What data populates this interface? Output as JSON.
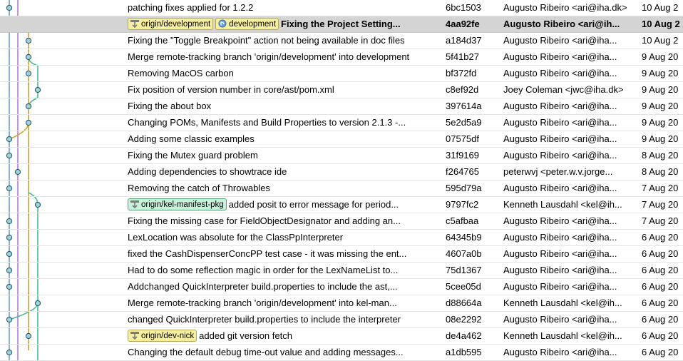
{
  "colors": {
    "lane_blue": "#6b9cc8",
    "lane_purple": "#b57ad0",
    "lane_gold": "#c8a233",
    "lane_teal": "#49b899",
    "selection": "#d4d4d4"
  },
  "commits": [
    {
      "subject": "patching fixes applied for 1.2.2",
      "refs": [],
      "sha": "6bc1503",
      "author": "Augusto Ribeiro <ari@iha.dk>",
      "date": "10 Aug 2",
      "lane": 0
    },
    {
      "subject": "Fixing the Project Setting...",
      "refs": [
        {
          "label": "origin/development",
          "kind": "remote",
          "icon": "remote-branch-icon"
        },
        {
          "label": "development",
          "kind": "local",
          "icon": "local-branch-icon"
        }
      ],
      "sha": "4aa92fe",
      "author": "Augusto Ribeiro <ari@ih...",
      "date": "10 Aug 2",
      "lane": 2,
      "selected": true
    },
    {
      "subject": "Fixing the \"Toggle Breakpoint\" action not being available in doc files",
      "refs": [],
      "sha": "a184d37",
      "author": "Augusto Ribeiro <ari@iha...",
      "date": "10 Aug 2",
      "lane": 2
    },
    {
      "subject": "Merge remote-tracking branch 'origin/development' into development",
      "refs": [],
      "sha": "5f41b27",
      "author": "Augusto Ribeiro <ari@iha...",
      "date": "9 Aug 20",
      "lane": 2
    },
    {
      "subject": "Removing MacOS carbon",
      "refs": [],
      "sha": "bf372fd",
      "author": "Augusto Ribeiro <ari@iha...",
      "date": "9 Aug 20",
      "lane": 2
    },
    {
      "subject": "Fix position of version number in core/ast/pom.xml",
      "refs": [],
      "sha": "c8ef92d",
      "author": "Joey Coleman <jwc@iha.dk>",
      "date": "9 Aug 20",
      "lane": 3
    },
    {
      "subject": "Fixing the about box",
      "refs": [],
      "sha": "397614a",
      "author": "Augusto Ribeiro <ari@iha...",
      "date": "9 Aug 20",
      "lane": 2
    },
    {
      "subject": "Changing POMs, Manifests and Build Properties to version 2.1.3 -...",
      "refs": [],
      "sha": "5e2d5a9",
      "author": "Augusto Ribeiro <ari@iha...",
      "date": "9 Aug 20",
      "lane": 2
    },
    {
      "subject": "Adding some classic examples",
      "refs": [],
      "sha": "07575df",
      "author": "Augusto Ribeiro <ari@iha...",
      "date": "9 Aug 20",
      "lane": 0
    },
    {
      "subject": "Fixing the Mutex guard problem",
      "refs": [],
      "sha": "31f9169",
      "author": "Augusto Ribeiro <ari@iha...",
      "date": "8 Aug 20",
      "lane": 0
    },
    {
      "subject": "Adding dependencies to showtrace ide",
      "refs": [],
      "sha": "f264765",
      "author": "peterwvj <peter.w.v.jorge...",
      "date": "8 Aug 20",
      "lane": 1
    },
    {
      "subject": "Removing the catch of Throwables",
      "refs": [],
      "sha": "595d79a",
      "author": "Augusto Ribeiro <ari@iha...",
      "date": "7 Aug 20",
      "lane": 0
    },
    {
      "subject": "added posit to error message for period...",
      "refs": [
        {
          "label": "origin/kel-manifest-pkg",
          "kind": "remote-green",
          "icon": "remote-branch-icon"
        }
      ],
      "sha": "9797fc2",
      "author": "Kenneth Lausdahl <kel@ih...",
      "date": "7 Aug 20",
      "lane": 3
    },
    {
      "subject": "Fixing the missing case for FieldObjectDesignator and adding an...",
      "refs": [],
      "sha": "c5afbaa",
      "author": "Augusto Ribeiro <ari@iha...",
      "date": "7 Aug 20",
      "lane": 0
    },
    {
      "subject": "LexLocation was absolute for the ClassPpInterpreter",
      "refs": [],
      "sha": "64345b9",
      "author": "Augusto Ribeiro <ari@iha...",
      "date": "6 Aug 20",
      "lane": 0
    },
    {
      "subject": "fixed the CashDispenserConcPP test case - it was missing the ent...",
      "refs": [],
      "sha": "4607a0b",
      "author": "Augusto Ribeiro <ari@iha...",
      "date": "6 Aug 20",
      "lane": 0
    },
    {
      "subject": "Had to do some reflection magic in order for the LexNameList to...",
      "refs": [],
      "sha": "75d1367",
      "author": "Augusto Ribeiro <ari@iha...",
      "date": "6 Aug 20",
      "lane": 0
    },
    {
      "subject": "Addchanged QuickInterpreter build.properties to include the ast,...",
      "refs": [],
      "sha": "5cee05d",
      "author": "Augusto Ribeiro <ari@iha...",
      "date": "6 Aug 20",
      "lane": 0
    },
    {
      "subject": "Merge remote-tracking branch 'origin/development' into kel-man...",
      "refs": [],
      "sha": "d88664a",
      "author": "Kenneth Lausdahl <kel@ih...",
      "date": "6 Aug 20",
      "lane": 3
    },
    {
      "subject": "changed QuickInterpreter build.properties to include the interpreter",
      "refs": [],
      "sha": "08e2292",
      "author": "Augusto Ribeiro <ari@iha...",
      "date": "6 Aug 20",
      "lane": 0
    },
    {
      "subject": "added git version fetch",
      "refs": [
        {
          "label": "origin/dev-nick",
          "kind": "remote",
          "icon": "remote-branch-icon"
        }
      ],
      "sha": "de4a462",
      "author": "Kenneth Lausdahl <kel@ih...",
      "date": "6 Aug 20",
      "lane": 2
    },
    {
      "subject": "Changing the default debug time-out value and adding messages...",
      "refs": [],
      "sha": "a1db595",
      "author": "Augusto Ribeiro <ari@iha...",
      "date": "6 Aug 20",
      "lane": 0
    }
  ]
}
